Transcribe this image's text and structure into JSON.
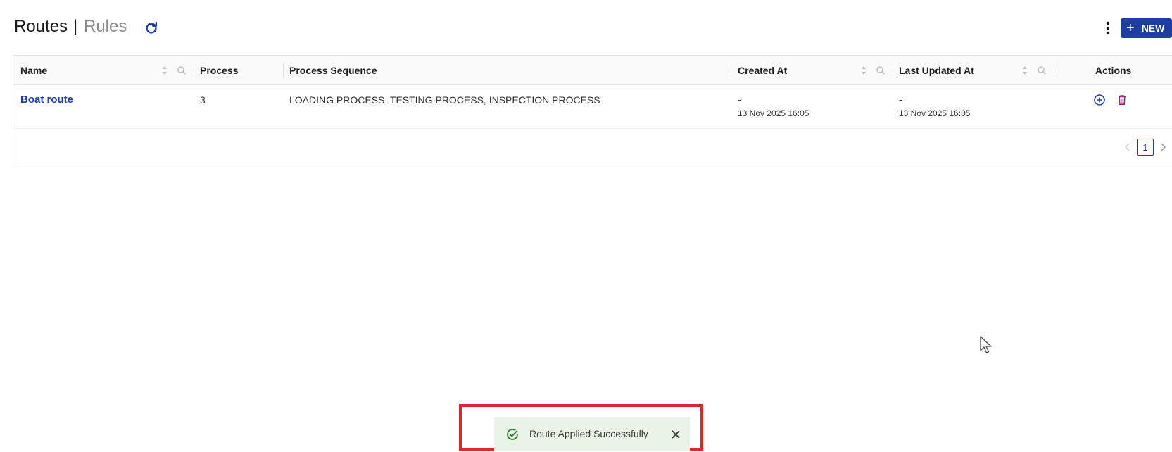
{
  "header": {
    "title_active": "Routes",
    "separator": "|",
    "title_inactive": "Rules",
    "new_label": "NEW"
  },
  "table": {
    "columns": [
      "Name",
      "Process",
      "Process Sequence",
      "Created At",
      "Last Updated At",
      "Actions"
    ],
    "rows": [
      {
        "name": "Boat route",
        "process": "3",
        "sequence": "LOADING PROCESS, TESTING PROCESS, INSPECTION PROCESS",
        "created_by": "-",
        "created_at": "13 Nov 2025 16:05",
        "updated_by": "-",
        "updated_at": "13 Nov 2025 16:05"
      }
    ]
  },
  "pagination": {
    "current_page": "1"
  },
  "toast": {
    "message": "Route Applied Successfully"
  },
  "colors": {
    "primary": "#1f3fa0",
    "delete": "#a0237a",
    "toast_bg": "#eaf4e6",
    "success": "#2e7d32",
    "highlight": "#e1262b"
  }
}
